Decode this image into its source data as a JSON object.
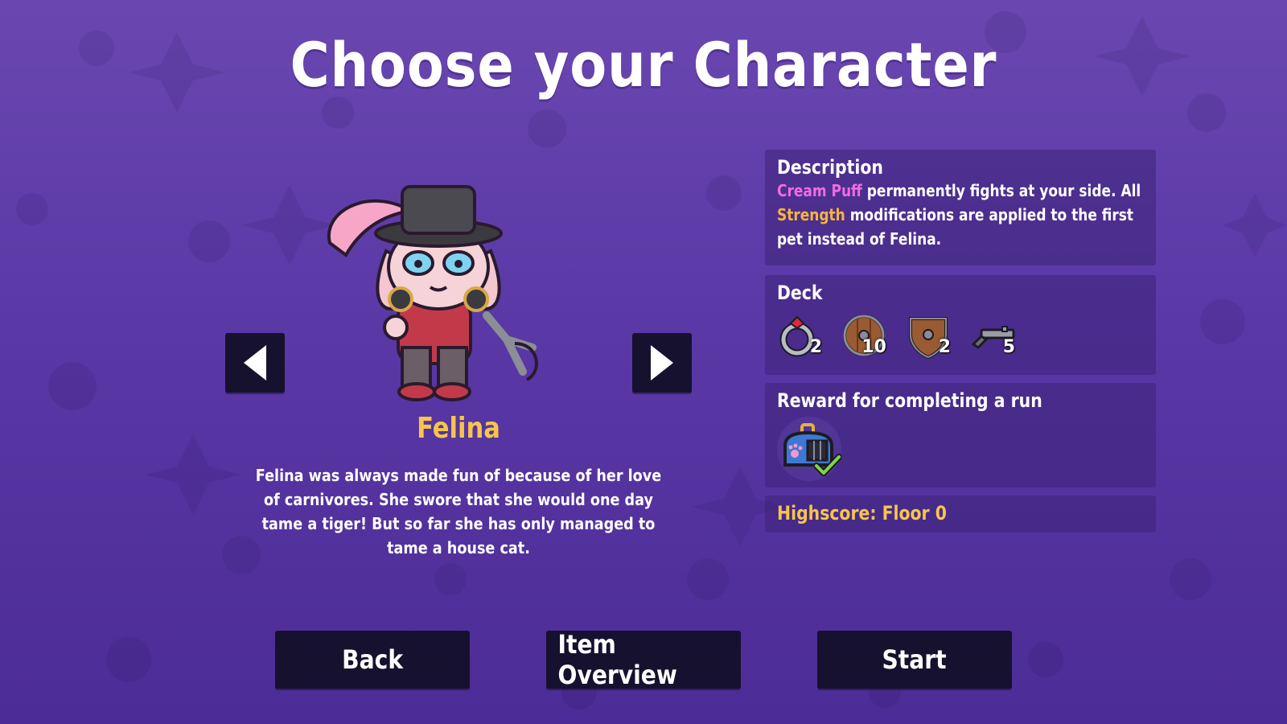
{
  "title": "Choose your Character",
  "character": {
    "name": "Felina",
    "bio": "Felina was always made fun of because of her love of carnivores. She swore that she would one day tame a tiger! But so far she has only managed to tame a house cat."
  },
  "description": {
    "title": "Description",
    "pet_name": "Cream Puff",
    "text_1": " permanently fights at your side. All ",
    "keyword": "Strength",
    "text_2": " modifications are applied to the first pet instead of Felina."
  },
  "deck": {
    "title": "Deck",
    "items": [
      {
        "icon": "ring-icon",
        "count": "2"
      },
      {
        "icon": "round-shield-icon",
        "count": "10"
      },
      {
        "icon": "heater-shield-icon",
        "count": "2"
      },
      {
        "icon": "pistol-icon",
        "count": "5"
      }
    ]
  },
  "reward": {
    "title": "Reward for completing a run",
    "icon": "pet-carrier-icon",
    "completed": true
  },
  "highscore": "Highscore: Floor 0",
  "buttons": {
    "back": "Back",
    "overview": "Item Overview",
    "start": "Start"
  },
  "colors": {
    "accent_gold": "#f6c54a",
    "accent_pink": "#f06ce0",
    "button_bg": "#16112e",
    "background": "#5a38a6"
  }
}
